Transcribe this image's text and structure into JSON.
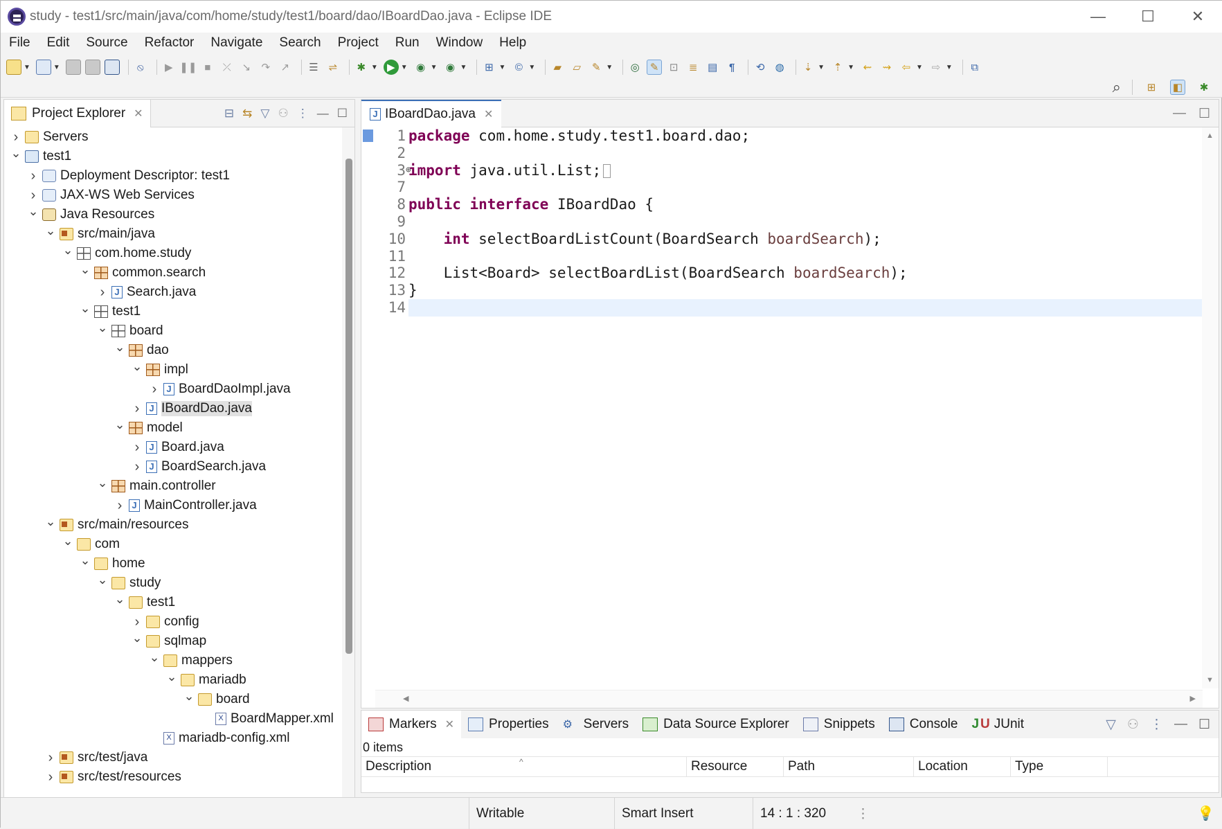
{
  "window": {
    "title": "study - test1/src/main/java/com/home/study/test1/board/dao/IBoardDao.java - Eclipse IDE",
    "minimize": "—",
    "maximize": "☐",
    "close": "✕"
  },
  "menu": [
    "File",
    "Edit",
    "Source",
    "Refactor",
    "Navigate",
    "Search",
    "Project",
    "Run",
    "Window",
    "Help"
  ],
  "project_explorer": {
    "title": "Project Explorer",
    "tree": [
      {
        "label": "Servers",
        "depth": 0,
        "twisty": "closed",
        "icon": "folder"
      },
      {
        "label": "test1",
        "depth": 0,
        "twisty": "open",
        "icon": "project"
      },
      {
        "label": "Deployment Descriptor: test1",
        "depth": 1,
        "twisty": "closed",
        "icon": "generic"
      },
      {
        "label": "JAX-WS Web Services",
        "depth": 1,
        "twisty": "closed",
        "icon": "generic"
      },
      {
        "label": "Java Resources",
        "depth": 1,
        "twisty": "open",
        "icon": "resources"
      },
      {
        "label": "src/main/java",
        "depth": 2,
        "twisty": "open",
        "icon": "srcfolder"
      },
      {
        "label": "com.home.study",
        "depth": 3,
        "twisty": "open",
        "icon": "package-empty"
      },
      {
        "label": "common.search",
        "depth": 4,
        "twisty": "open",
        "icon": "package"
      },
      {
        "label": "Search.java",
        "depth": 5,
        "twisty": "closed",
        "icon": "java"
      },
      {
        "label": "test1",
        "depth": 4,
        "twisty": "open",
        "icon": "package-empty"
      },
      {
        "label": "board",
        "depth": 5,
        "twisty": "open",
        "icon": "package-empty"
      },
      {
        "label": "dao",
        "depth": 6,
        "twisty": "open",
        "icon": "package"
      },
      {
        "label": "impl",
        "depth": 7,
        "twisty": "open",
        "icon": "package"
      },
      {
        "label": "BoardDaoImpl.java",
        "depth": 8,
        "twisty": "closed",
        "icon": "java"
      },
      {
        "label": "IBoardDao.java",
        "depth": 7,
        "twisty": "closed",
        "icon": "java",
        "selected": true
      },
      {
        "label": "model",
        "depth": 6,
        "twisty": "open",
        "icon": "package"
      },
      {
        "label": "Board.java",
        "depth": 7,
        "twisty": "closed",
        "icon": "java"
      },
      {
        "label": "BoardSearch.java",
        "depth": 7,
        "twisty": "closed",
        "icon": "java"
      },
      {
        "label": "main.controller",
        "depth": 5,
        "twisty": "open",
        "icon": "package"
      },
      {
        "label": "MainController.java",
        "depth": 6,
        "twisty": "closed",
        "icon": "java"
      },
      {
        "label": "src/main/resources",
        "depth": 2,
        "twisty": "open",
        "icon": "srcfolder"
      },
      {
        "label": "com",
        "depth": 3,
        "twisty": "open",
        "icon": "folder"
      },
      {
        "label": "home",
        "depth": 4,
        "twisty": "open",
        "icon": "folder"
      },
      {
        "label": "study",
        "depth": 5,
        "twisty": "open",
        "icon": "folder"
      },
      {
        "label": "test1",
        "depth": 6,
        "twisty": "open",
        "icon": "folder"
      },
      {
        "label": "config",
        "depth": 7,
        "twisty": "closed",
        "icon": "folder"
      },
      {
        "label": "sqlmap",
        "depth": 7,
        "twisty": "open",
        "icon": "folder"
      },
      {
        "label": "mappers",
        "depth": 8,
        "twisty": "open",
        "icon": "folder"
      },
      {
        "label": "mariadb",
        "depth": 9,
        "twisty": "open",
        "icon": "folder"
      },
      {
        "label": "board",
        "depth": 10,
        "twisty": "open",
        "icon": "folder"
      },
      {
        "label": "BoardMapper.xml",
        "depth": 11,
        "twisty": "none",
        "icon": "xml"
      },
      {
        "label": "mariadb-config.xml",
        "depth": 8,
        "twisty": "none",
        "icon": "xml"
      },
      {
        "label": "src/test/java",
        "depth": 2,
        "twisty": "closed",
        "icon": "srcfolder"
      },
      {
        "label": "src/test/resources",
        "depth": 2,
        "twisty": "closed",
        "icon": "srcfolder"
      }
    ]
  },
  "editor": {
    "tab_label": "IBoardDao.java",
    "lines": [
      {
        "num": "1",
        "tokens": [
          {
            "t": "package",
            "c": "kw"
          },
          {
            "t": " com.home.study.test1.board.dao;",
            "c": ""
          }
        ],
        "marker": true
      },
      {
        "num": "2",
        "tokens": []
      },
      {
        "num": "3",
        "tokens": [
          {
            "t": "import",
            "c": "kw"
          },
          {
            "t": " java.util.List;",
            "c": ""
          }
        ],
        "fold": true
      },
      {
        "num": "7",
        "tokens": []
      },
      {
        "num": "8",
        "tokens": [
          {
            "t": "public",
            "c": "kw"
          },
          {
            "t": " ",
            "c": ""
          },
          {
            "t": "interface",
            "c": "kw"
          },
          {
            "t": " IBoardDao {",
            "c": ""
          }
        ]
      },
      {
        "num": "9",
        "tokens": []
      },
      {
        "num": "10",
        "tokens": [
          {
            "t": "    ",
            "c": ""
          },
          {
            "t": "int",
            "c": "kw"
          },
          {
            "t": " selectBoardListCount(BoardSearch ",
            "c": ""
          },
          {
            "t": "boardSearch",
            "c": "param"
          },
          {
            "t": ");",
            "c": ""
          }
        ]
      },
      {
        "num": "11",
        "tokens": []
      },
      {
        "num": "12",
        "tokens": [
          {
            "t": "    List<Board> selectBoardList(BoardSearch ",
            "c": ""
          },
          {
            "t": "boardSearch",
            "c": "param"
          },
          {
            "t": ");",
            "c": ""
          }
        ]
      },
      {
        "num": "13",
        "tokens": [
          {
            "t": "}",
            "c": ""
          }
        ]
      },
      {
        "num": "14",
        "tokens": [],
        "current": true
      }
    ]
  },
  "bottom": {
    "tabs": [
      "Markers",
      "Properties",
      "Servers",
      "Data Source Explorer",
      "Snippets",
      "Console",
      "JUnit"
    ],
    "items_count": "0 items",
    "columns": [
      "Description",
      "Resource",
      "Path",
      "Location",
      "Type"
    ]
  },
  "status": {
    "writable": "Writable",
    "insert_mode": "Smart Insert",
    "position": "14 : 1 : 320"
  }
}
